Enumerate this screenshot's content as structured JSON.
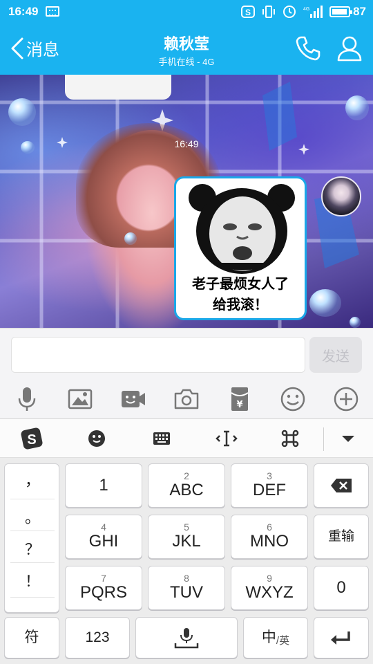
{
  "status_bar": {
    "time": "16:49",
    "battery": "87",
    "network": "4G"
  },
  "header": {
    "back_label": "消息",
    "contact_name": "赖秋莹",
    "contact_status": "手机在线 - 4G"
  },
  "chat": {
    "timestamp": "16:49",
    "message": {
      "caption_line1": "老子最烦女人了",
      "caption_line2": "给我滚！"
    }
  },
  "input": {
    "send_label": "发送"
  },
  "keyboard": {
    "punctuation": [
      "，",
      "。",
      "？",
      "！"
    ],
    "keys": [
      {
        "num": "",
        "letters": "1"
      },
      {
        "num": "2",
        "letters": "ABC"
      },
      {
        "num": "3",
        "letters": "DEF"
      },
      {
        "num": "4",
        "letters": "GHI"
      },
      {
        "num": "5",
        "letters": "JKL"
      },
      {
        "num": "6",
        "letters": "MNO"
      },
      {
        "num": "7",
        "letters": "PQRS"
      },
      {
        "num": "8",
        "letters": "TUV"
      },
      {
        "num": "9",
        "letters": "WXYZ"
      }
    ],
    "retype_label": "重输",
    "zero_label": "0",
    "symbol_label": "符",
    "num_label": "123",
    "lang_main": "中",
    "lang_sub": "/英"
  },
  "colors": {
    "header_blue": "#1ab3f0",
    "bubble_border": "#1aa7e8"
  }
}
